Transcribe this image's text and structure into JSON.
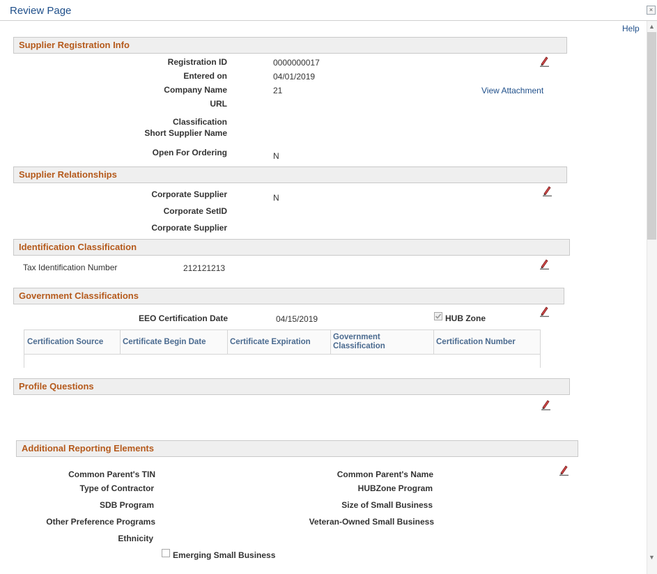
{
  "window": {
    "title": "Review Page",
    "help": "Help"
  },
  "supplier_registration": {
    "heading": "Supplier Registration Info",
    "registration_id_label": "Registration ID",
    "registration_id": "0000000017",
    "entered_on_label": "Entered on",
    "entered_on": "04/01/2019",
    "company_name_label": "Company Name",
    "company_name": "21",
    "view_attachment": "View Attachment",
    "url_label": "URL",
    "classification_label": "Classification",
    "short_name_label": "Short Supplier Name",
    "open_for_ordering_label": "Open For Ordering",
    "open_for_ordering": "N"
  },
  "supplier_relationships": {
    "heading": "Supplier Relationships",
    "corporate_supplier_label": "Corporate Supplier",
    "corporate_supplier": "N",
    "corporate_setid_label": "Corporate SetID",
    "corporate_supplier2_label": "Corporate Supplier"
  },
  "identification": {
    "heading": "Identification Classification",
    "tin_label": "Tax Identification Number",
    "tin": "212121213"
  },
  "government": {
    "heading": "Government Classifications",
    "eeo_label": "EEO Certification Date",
    "eeo_date": "04/15/2019",
    "hub_zone_label": "HUB Zone",
    "hub_zone_checked": true,
    "columns": [
      "Certification Source",
      "Certificate Begin Date",
      "Certificate Expiration",
      "Government Classification",
      "Certification Number"
    ]
  },
  "profile": {
    "heading": "Profile Questions"
  },
  "additional": {
    "heading": "Additional Reporting Elements",
    "parent_tin_label": "Common Parent's TIN",
    "contractor_type_label": "Type of Contractor",
    "sdb_label": "SDB Program",
    "other_pref_label": "Other Preference Programs",
    "ethnicity_label": "Ethnicity",
    "emerging_label": "Emerging Small Business",
    "parent_name_label": "Common Parent's Name",
    "hubzone_program_label": "HUBZone Program",
    "size_label": "Size of Small Business",
    "veteran_label": "Veteran-Owned Small Business"
  },
  "colors": {
    "heading": "#b55a1c",
    "link": "#1f4f8a"
  },
  "icons": {
    "edit": "pencil-edit-icon",
    "close": "close-icon"
  }
}
